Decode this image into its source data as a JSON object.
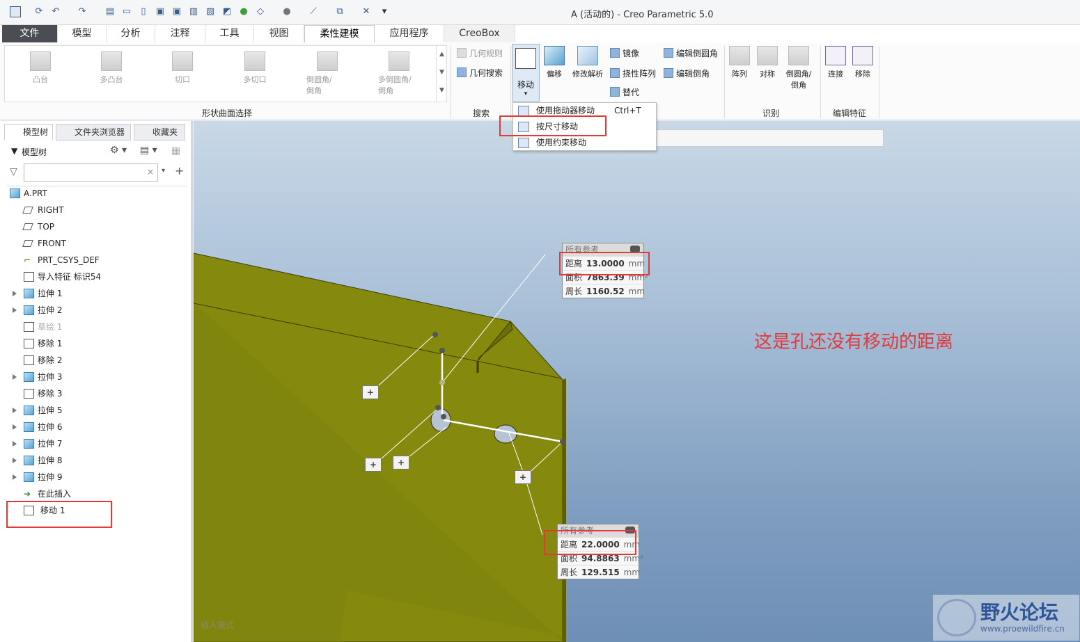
{
  "window": {
    "title": "A (活动的) - Creo Parametric 5.0"
  },
  "tabs": [
    "文件",
    "模型",
    "分析",
    "注释",
    "工具",
    "视图",
    "柔性建模",
    "应用程序",
    "CreoBox"
  ],
  "ribbon": {
    "shape_group": {
      "label": "形状曲面选择",
      "buttons": [
        "凸台",
        "多凸台",
        "切口",
        "多切口",
        "倒圆角/\n倒角",
        "多倒圆角/\n倒角"
      ]
    },
    "search_group": {
      "label": "搜索",
      "items": [
        "几何规则",
        "几何搜索"
      ]
    },
    "transform_group": {
      "move": "移动",
      "offset": "偏移",
      "modify_analytic": "修改解析",
      "mirror": "镜像",
      "flex_pattern": "挠性阵列",
      "replace": "替代",
      "edit_round": "编辑倒圆角",
      "edit_chamfer": "编辑倒角"
    },
    "recognize_group": {
      "label": "识别",
      "pattern": "阵列",
      "symmetry": "对称",
      "round_chamfer": "倒圆角/\n倒角"
    },
    "edit_feature_group": {
      "label": "编辑特征",
      "attach": "连接",
      "remove": "移除"
    }
  },
  "move_menu": [
    {
      "label": "使用拖动器移动",
      "shortcut": "Ctrl+T"
    },
    {
      "label": "按尺寸移动",
      "shortcut": ""
    },
    {
      "label": "使用约束移动",
      "shortcut": ""
    }
  ],
  "panel": {
    "tabs": [
      "模型树",
      "文件夹浏览器",
      "收藏夹"
    ],
    "header": "模型树",
    "tree": [
      {
        "label": "A.PRT",
        "icon": "part-icon",
        "expandable": false
      },
      {
        "label": "RIGHT",
        "icon": "datum-plane-icon",
        "expandable": false
      },
      {
        "label": "TOP",
        "icon": "datum-plane-icon",
        "expandable": false
      },
      {
        "label": "FRONT",
        "icon": "datum-plane-icon",
        "expandable": false
      },
      {
        "label": "PRT_CSYS_DEF",
        "icon": "csys-icon",
        "expandable": false
      },
      {
        "label": "导入特征 标识54",
        "icon": "import-icon",
        "expandable": false
      },
      {
        "label": "拉伸 1",
        "icon": "extrude-icon",
        "expandable": true
      },
      {
        "label": "拉伸 2",
        "icon": "extrude-icon",
        "expandable": true
      },
      {
        "label": "草绘 1",
        "icon": "sketch-icon",
        "expandable": false,
        "dim": true
      },
      {
        "label": "移除 1",
        "icon": "remove-icon",
        "expandable": false
      },
      {
        "label": "移除 2",
        "icon": "remove-icon",
        "expandable": false
      },
      {
        "label": "拉伸 3",
        "icon": "extrude-icon",
        "expandable": true
      },
      {
        "label": "移除 3",
        "icon": "remove-icon",
        "expandable": false
      },
      {
        "label": "拉伸 5",
        "icon": "extrude-icon",
        "expandable": true
      },
      {
        "label": "拉伸 6",
        "icon": "extrude-icon",
        "expandable": true
      },
      {
        "label": "拉伸 7",
        "icon": "extrude-icon",
        "expandable": true
      },
      {
        "label": "拉伸 8",
        "icon": "extrude-icon",
        "expandable": true
      },
      {
        "label": "拉伸 9",
        "icon": "extrude-icon",
        "expandable": true
      },
      {
        "label": "在此插入",
        "icon": "insert-arrow-icon",
        "expandable": false
      },
      {
        "label": "移动 1",
        "icon": "move-icon",
        "expandable": false
      }
    ]
  },
  "popups": [
    {
      "header": "所有参考",
      "rows": [
        {
          "k": "距离",
          "v": "13.0000",
          "u": "mm"
        },
        {
          "k": "面积",
          "v": "7863.39",
          "u": "mm²"
        },
        {
          "k": "周长",
          "v": "1160.52",
          "u": "mm"
        }
      ]
    },
    {
      "header": "所有参考",
      "rows": [
        {
          "k": "距离",
          "v": "22.0000",
          "u": "mm"
        },
        {
          "k": "面积",
          "v": "94.8863",
          "u": "mm²"
        },
        {
          "k": "周长",
          "v": "129.515",
          "u": "mm"
        }
      ]
    }
  ],
  "annotation": "这是孔还没有移动的距离",
  "status_hint": "插入模式",
  "watermark": {
    "title": "野火论坛",
    "url": "www.proewildfire.cn"
  },
  "colors": {
    "part": "#858a0e",
    "accent_red": "#e53935",
    "file_tab": "#4a4e54"
  }
}
